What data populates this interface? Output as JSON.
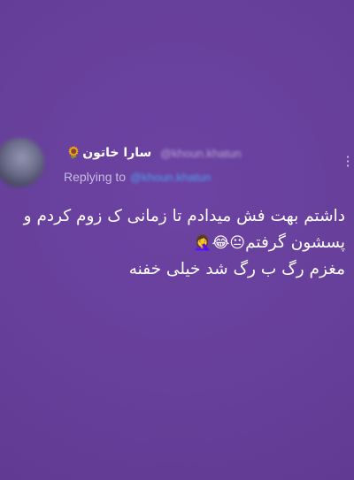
{
  "tweet": {
    "display_name": "سارا خاتون",
    "name_emoji": "🌻",
    "handle": "@khoun.khatun",
    "replying_label": "Replying to",
    "replying_handle": "@khoun.khatun",
    "more_icon": "more-vertical-icon",
    "body_line_1": "داشتم بهت فش میدادم تا زمانی ک زوم کردم و",
    "body_line_2": "پسشون گرفتم",
    "body_emojis": "😐😂🤦‍♀️",
    "body_line_3": "مغزم رگ ب رگ شد خیلی خفنه"
  },
  "colors": {
    "background": "#6a3f9e",
    "text": "#ffffff",
    "link": "#4fa3f0",
    "muted": "#c8bbe0"
  }
}
